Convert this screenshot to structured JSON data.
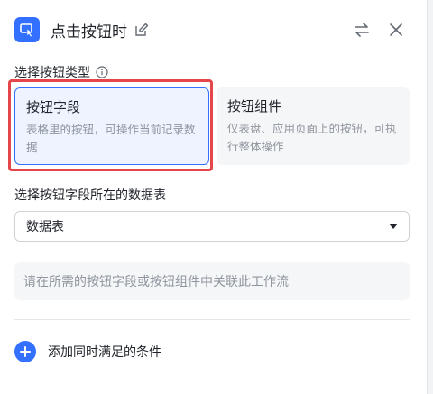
{
  "header": {
    "title": "点击按钮时",
    "icons": {
      "app": "cursor-click-icon",
      "edit": "edit-icon",
      "switch": "swap-arrows-icon",
      "close": "close-icon"
    }
  },
  "button_type_section": {
    "label": "选择按钮类型",
    "info_icon": "info-icon",
    "options": [
      {
        "title": "按钮字段",
        "description": "表格里的按钮，可操作当前记录数据",
        "selected": true
      },
      {
        "title": "按钮组件",
        "description": "仪表盘、应用页面上的按钮，可执行整体操作",
        "selected": false
      }
    ]
  },
  "table_section": {
    "label": "选择按钮字段所在的数据表",
    "select_value": "数据表"
  },
  "hint": "请在所需的按钮字段或按钮组件中关联此工作流",
  "add_condition": {
    "label": "添加同时满足的条件",
    "icon": "plus-circle-icon"
  },
  "colors": {
    "accent": "#3370ff",
    "highlight": "#e5464a",
    "selected_bg": "#eef3ff",
    "muted_text": "#8f959e"
  }
}
